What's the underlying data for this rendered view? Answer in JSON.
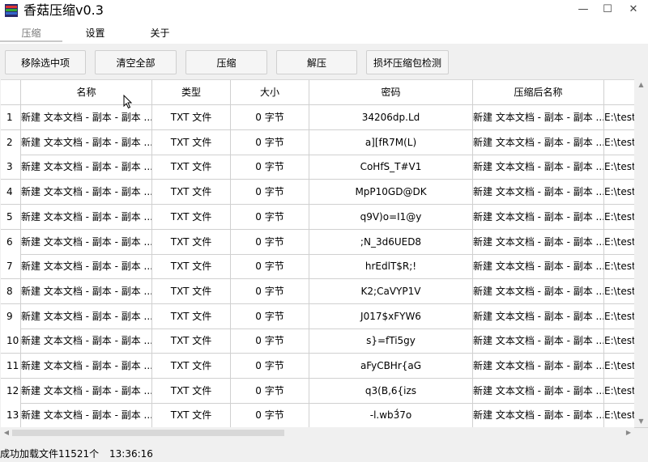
{
  "window": {
    "title": "香菇压缩v0.3",
    "controls": {
      "minimize": "—",
      "maximize": "☐",
      "close": "✕"
    }
  },
  "tabs": [
    "压缩",
    "设置",
    "关于"
  ],
  "toolbar": {
    "remove_selected": "移除选中项",
    "clear_all": "清空全部",
    "compress": "压缩",
    "decompress": "解压",
    "detect_corrupt": "损坏压缩包检测"
  },
  "table": {
    "columns": [
      "名称",
      "类型",
      "大小",
      "密码",
      "压缩后名称"
    ],
    "rows": [
      {
        "num": "1",
        "name": "新建 文本文档 - 副本 - 副本 ...",
        "type": "TXT 文件",
        "size": "0 字节",
        "password": "34206dp.Ld",
        "out_name": "新建 文本文档 - 副本 - 副本 ...",
        "path": "E:\\test"
      },
      {
        "num": "2",
        "name": "新建 文本文档 - 副本 - 副本 ...",
        "type": "TXT 文件",
        "size": "0 字节",
        "password": "a][fR7M(L)",
        "out_name": "新建 文本文档 - 副本 - 副本 ...",
        "path": "E:\\test"
      },
      {
        "num": "3",
        "name": "新建 文本文档 - 副本 - 副本 ...",
        "type": "TXT 文件",
        "size": "0 字节",
        "password": "CoHfS_T#V1",
        "out_name": "新建 文本文档 - 副本 - 副本 ...",
        "path": "E:\\test"
      },
      {
        "num": "4",
        "name": "新建 文本文档 - 副本 - 副本 ...",
        "type": "TXT 文件",
        "size": "0 字节",
        "password": "MpP10GD@DK",
        "out_name": "新建 文本文档 - 副本 - 副本 ...",
        "path": "E:\\test"
      },
      {
        "num": "5",
        "name": "新建 文本文档 - 副本 - 副本 ...",
        "type": "TXT 文件",
        "size": "0 字节",
        "password": "q9V)o=I1@y",
        "out_name": "新建 文本文档 - 副本 - 副本 ...",
        "path": "E:\\test"
      },
      {
        "num": "6",
        "name": "新建 文本文档 - 副本 - 副本 ...",
        "type": "TXT 文件",
        "size": "0 字节",
        "password": ";N_3d6UED8",
        "out_name": "新建 文本文档 - 副本 - 副本 ...",
        "path": "E:\\test"
      },
      {
        "num": "7",
        "name": "新建 文本文档 - 副本 - 副本 ...",
        "type": "TXT 文件",
        "size": "0 字节",
        "password": "hrEdlT$R;!",
        "out_name": "新建 文本文档 - 副本 - 副本 ...",
        "path": "E:\\test"
      },
      {
        "num": "8",
        "name": "新建 文本文档 - 副本 - 副本 ...",
        "type": "TXT 文件",
        "size": "0 字节",
        "password": "K2;CaVYP1V",
        "out_name": "新建 文本文档 - 副本 - 副本 ...",
        "path": "E:\\test"
      },
      {
        "num": "9",
        "name": "新建 文本文档 - 副本 - 副本 ...",
        "type": "TXT 文件",
        "size": "0 字节",
        "password": "J017$xFYW6",
        "out_name": "新建 文本文档 - 副本 - 副本 ...",
        "path": "E:\\test"
      },
      {
        "num": "10",
        "name": "新建 文本文档 - 副本 - 副本 ...",
        "type": "TXT 文件",
        "size": "0 字节",
        "password": "s}=fTi5gy",
        "out_name": "新建 文本文档 - 副本 - 副本 ...",
        "path": "E:\\test"
      },
      {
        "num": "11",
        "name": "新建 文本文档 - 副本 - 副本 ...",
        "type": "TXT 文件",
        "size": "0 字节",
        "password": "aFyCBHr{aG",
        "out_name": "新建 文本文档 - 副本 - 副本 ...",
        "path": "E:\\test"
      },
      {
        "num": "12",
        "name": "新建 文本文档 - 副本 - 副本 ...",
        "type": "TXT 文件",
        "size": "0 字节",
        "password": "q3(B,6{izs",
        "out_name": "新建 文本文档 - 副本 - 副本 ...",
        "path": "E:\\test"
      },
      {
        "num": "13",
        "name": "新建 文本文档 - 副本 - 副本 ...",
        "type": "TXT 文件",
        "size": "0 字节",
        "password": "-l.wb3́7o",
        "out_name": "新建 文本文档 - 副本 - 副本 ...",
        "path": "E:\\test"
      }
    ]
  },
  "status": {
    "message": "成功加载文件11521个",
    "time": "13:36:16"
  },
  "icons": {
    "app": "app-icon",
    "cursor": "mouse-cursor-icon"
  },
  "colors": {
    "grid_line": "#d0d0d0",
    "button_border": "#cfcfcf",
    "inactive_tab": "#7a7a7a"
  }
}
